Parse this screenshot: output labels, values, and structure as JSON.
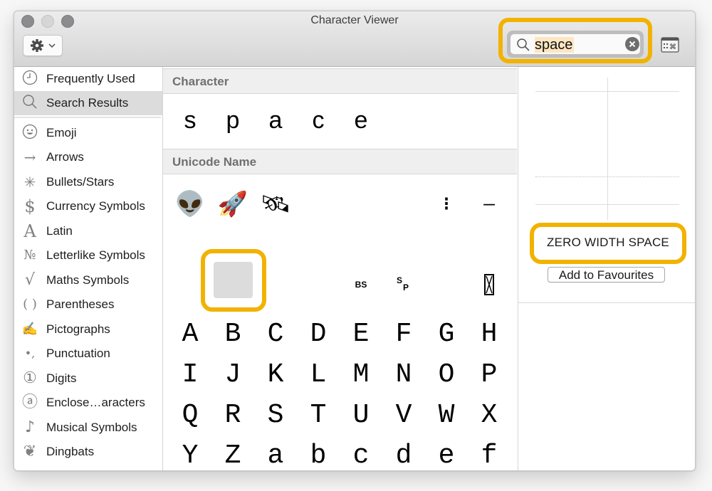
{
  "window": {
    "title": "Character Viewer"
  },
  "toolbar": {
    "action_menu_icon": "gear-icon",
    "search": {
      "value": "space",
      "placeholder": "Search",
      "clear_icon": "clear-icon"
    },
    "keyboard_viewer_icon": "keyboard-viewer-icon"
  },
  "sidebar": {
    "items": [
      {
        "label": "Frequently Used",
        "icon": "clock-icon",
        "glyph": "⌚",
        "selected": false
      },
      {
        "label": "Search Results",
        "icon": "search-icon",
        "glyph": "",
        "selected": true
      },
      {
        "label": "Emoji",
        "icon": "smiley-icon",
        "glyph": "☺",
        "selected": false
      },
      {
        "label": "Arrows",
        "icon": "arrow-icon",
        "glyph": "→",
        "selected": false
      },
      {
        "label": "Bullets/Stars",
        "icon": "asterisk-icon",
        "glyph": "✳",
        "selected": false
      },
      {
        "label": "Currency Symbols",
        "icon": "dollar-icon",
        "glyph": "$",
        "selected": false
      },
      {
        "label": "Latin",
        "icon": "latin-a-icon",
        "glyph": "A",
        "selected": false
      },
      {
        "label": "Letterlike Symbols",
        "icon": "numero-icon",
        "glyph": "№",
        "selected": false
      },
      {
        "label": "Maths Symbols",
        "icon": "square-root-icon",
        "glyph": "√",
        "selected": false
      },
      {
        "label": "Parentheses",
        "icon": "parentheses-icon",
        "glyph": "( )",
        "selected": false
      },
      {
        "label": "Pictographs",
        "icon": "pencil-icon",
        "glyph": "✍",
        "selected": false
      },
      {
        "label": "Punctuation",
        "icon": "punctuation-icon",
        "glyph": "•,",
        "selected": false
      },
      {
        "label": "Digits",
        "icon": "circled-one-icon",
        "glyph": "①",
        "selected": false
      },
      {
        "label": "Enclose…aracters",
        "icon": "circled-a-icon",
        "glyph": "ⓐ",
        "selected": false
      },
      {
        "label": "Musical Symbols",
        "icon": "music-note-icon",
        "glyph": "♪",
        "selected": false
      },
      {
        "label": "Dingbats",
        "icon": "heart-icon",
        "glyph": "❦",
        "selected": false
      }
    ]
  },
  "center": {
    "character_header": "Character",
    "character_letters": [
      "s",
      "p",
      "a",
      "c",
      "e"
    ],
    "unicode_name_header": "Unicode Name",
    "results_row1": [
      {
        "char": "👽",
        "name": "alien"
      },
      {
        "char": "🚀",
        "name": "rocket"
      },
      {
        "char": "🛰",
        "name": "satellite"
      },
      {
        "char": "",
        "name": "blank"
      },
      {
        "char": "",
        "name": "blank"
      },
      {
        "char": "",
        "name": "blank"
      },
      {
        "char": "⁝",
        "name": "tricolon-like"
      },
      {
        "char": "—",
        "name": "em-dash"
      }
    ],
    "results_row2": [
      {
        "char": "",
        "name": "blank"
      },
      {
        "char": "",
        "name": "zero-width-space",
        "selected": true
      },
      {
        "char": "",
        "name": "blank"
      },
      {
        "char": "",
        "name": "blank"
      },
      {
        "char": "BS",
        "name": "backspace-symbol"
      },
      {
        "char": "SP",
        "name": "space-symbol"
      },
      {
        "char": "",
        "name": "blank"
      },
      {
        "char": "X",
        "name": "boxed-x"
      }
    ],
    "letter_grid": [
      [
        "A",
        "B",
        "C",
        "D",
        "E",
        "F",
        "G",
        "H"
      ],
      [
        "I",
        "J",
        "K",
        "L",
        "M",
        "N",
        "O",
        "P"
      ],
      [
        "Q",
        "R",
        "S",
        "T",
        "U",
        "V",
        "W",
        "X"
      ],
      [
        "Y",
        "Z",
        "a",
        "b",
        "c",
        "d",
        "e",
        "f"
      ]
    ]
  },
  "detail": {
    "character_name": "ZERO WIDTH SPACE",
    "add_to_favourites_label": "Add to Favourites"
  },
  "colors": {
    "highlight": "#f2b200",
    "search_match": "#fde6c2",
    "selection": "#dcdcdc"
  }
}
